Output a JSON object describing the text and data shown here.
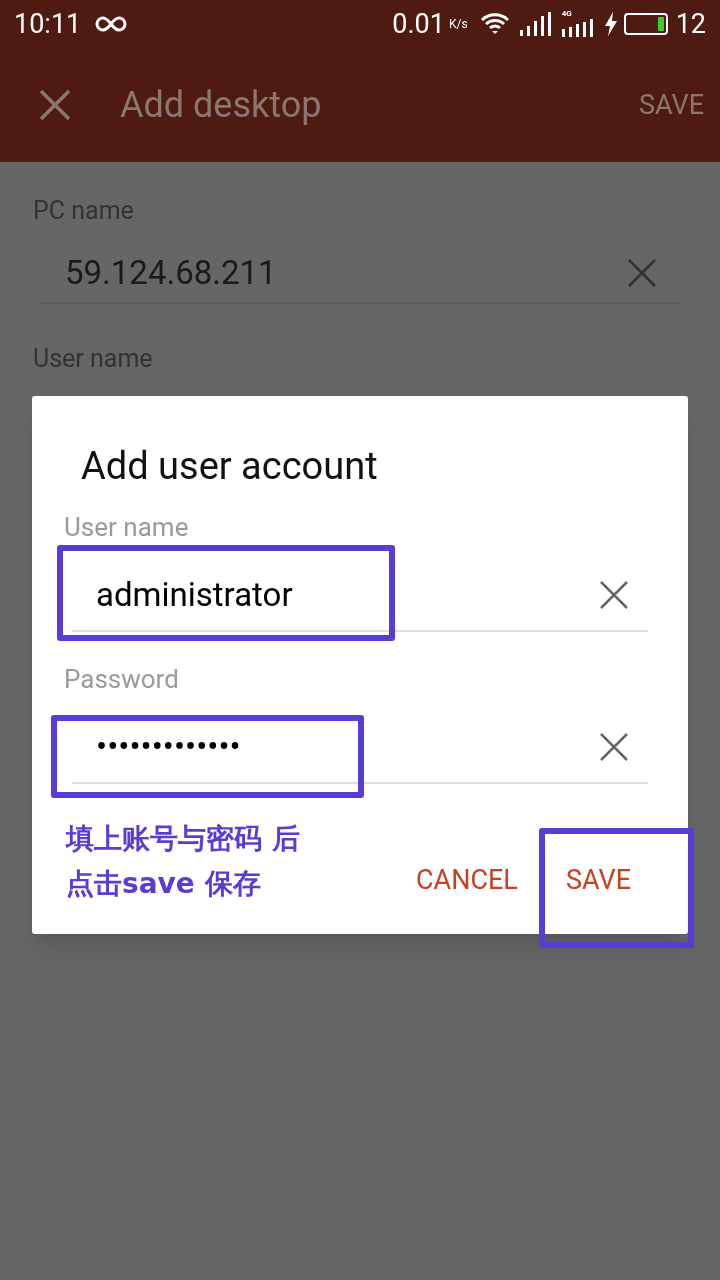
{
  "status_bar": {
    "time": "10:11",
    "net_speed": "0.01",
    "speed_unit": "K/s",
    "network": "4G",
    "battery": "12"
  },
  "app_bar": {
    "title": "Add desktop",
    "action": "SAVE"
  },
  "form": {
    "fields": [
      {
        "label": "PC name",
        "value": "59.124.68.211"
      }
    ],
    "next_label": "User name"
  },
  "dialog": {
    "title": "Add user account",
    "fields": [
      {
        "label": "User name",
        "value": "administrator",
        "highlighted": true
      },
      {
        "label": "Password",
        "value": "•••••••••••••",
        "highlighted": true
      }
    ],
    "note": [
      "填上账号与密码 后",
      "点击save 保存"
    ],
    "buttons": [
      {
        "label": "CANCEL",
        "highlighted": false
      },
      {
        "label": "SAVE",
        "highlighted": true
      }
    ]
  }
}
